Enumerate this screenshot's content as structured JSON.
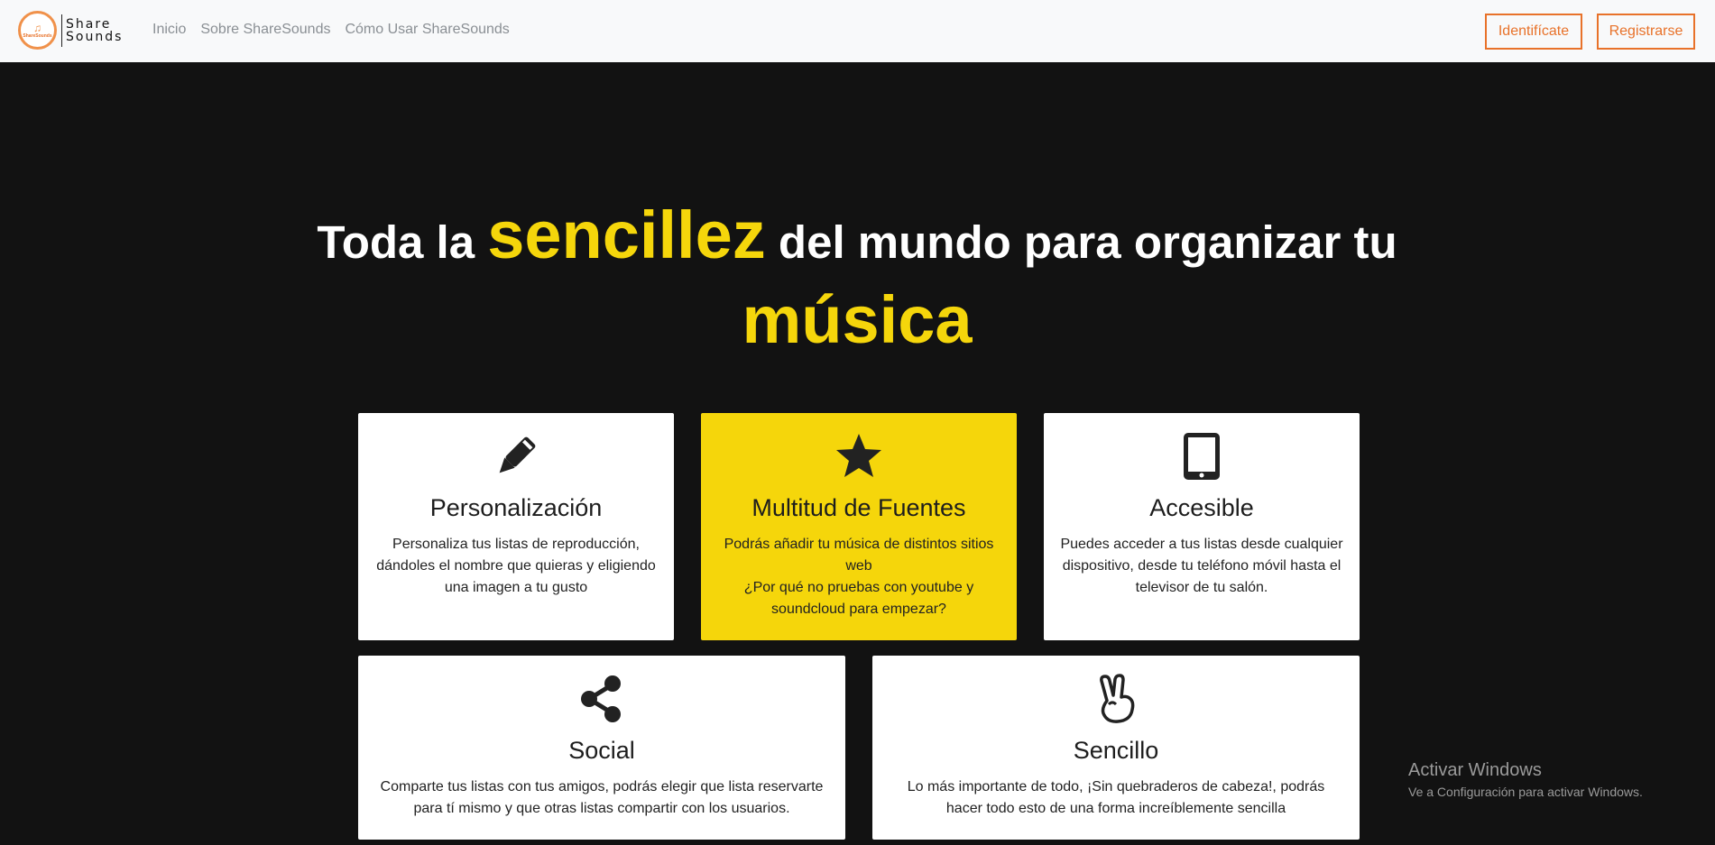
{
  "brand": {
    "logo_mini": "ShareSounds",
    "name_line1": "Share",
    "name_line2": "Sounds"
  },
  "nav": {
    "items": [
      {
        "label": "Inicio"
      },
      {
        "label": "Sobre ShareSounds"
      },
      {
        "label": "Cómo Usar ShareSounds"
      }
    ],
    "login_label": "Identifícate",
    "register_label": "Registrarse"
  },
  "hero": {
    "part1": "Toda la ",
    "highlight1": "sencillez",
    "part2": " del mundo para organizar tu",
    "highlight2": "música"
  },
  "features": [
    {
      "icon": "pen-icon",
      "title": "Personalización",
      "text": "Personaliza tus listas de reproducción, dándoles el nombre que quieras y eligiendo una imagen a tu gusto"
    },
    {
      "icon": "star-icon",
      "title": "Multitud de Fuentes",
      "text_line1": "Podrás añadir tu música de distintos sitios web",
      "text_line2": "¿Por qué no pruebas con youtube y soundcloud para empezar?"
    },
    {
      "icon": "tablet-icon",
      "title": "Accesible",
      "text": "Puedes acceder a tus listas desde cualquier dispositivo, desde tu teléfono móvil hasta el televisor de tu salón."
    },
    {
      "icon": "share-icon",
      "title": "Social",
      "text": "Comparte tus listas con tus amigos, podrás elegir que lista reservarte para tí mismo y que otras listas compartir con los usuarios."
    },
    {
      "icon": "hand-peace-icon",
      "title": "Sencillo",
      "text": "Lo más importante de todo, ¡Sin quebraderos de cabeza!, podrás hacer todo esto de una forma increíblemente sencilla"
    }
  ],
  "colors": {
    "accent_yellow": "#f5d60b",
    "accent_orange": "#e8722a",
    "background": "#121212"
  },
  "watermark": {
    "title": "Activar Windows",
    "subtitle": "Ve a Configuración para activar Windows."
  }
}
